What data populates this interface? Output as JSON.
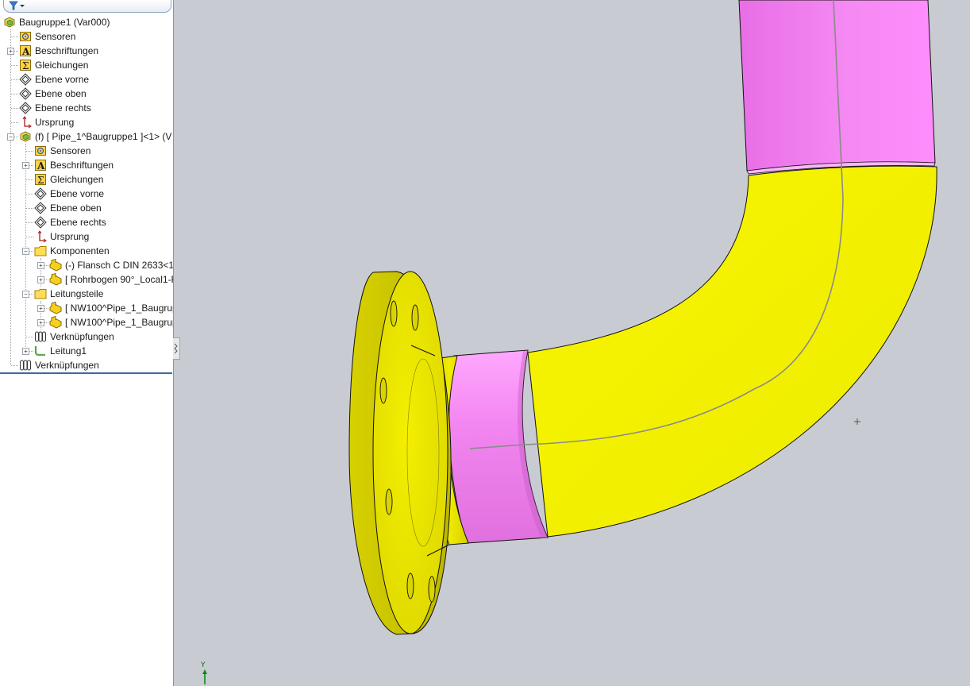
{
  "feature_tree": {
    "root": {
      "label": "Baugruppe1  (Var000)"
    },
    "items": [
      {
        "label": "Sensoren",
        "icon": "sensor-icon"
      },
      {
        "label": "Beschriftungen",
        "icon": "annotation-icon"
      },
      {
        "label": "Gleichungen",
        "icon": "equation-icon"
      },
      {
        "label": "Ebene vorne",
        "icon": "plane-icon"
      },
      {
        "label": "Ebene oben",
        "icon": "plane-icon"
      },
      {
        "label": "Ebene rechts",
        "icon": "plane-icon"
      },
      {
        "label": "Ursprung",
        "icon": "origin-icon"
      },
      {
        "label": "(f) [ Pipe_1^Baugruppe1 ]<1> (V",
        "icon": "subassembly-icon"
      },
      {
        "label": "Sensoren",
        "icon": "sensor-icon"
      },
      {
        "label": "Beschriftungen",
        "icon": "annotation-icon"
      },
      {
        "label": "Gleichungen",
        "icon": "equation-icon"
      },
      {
        "label": "Ebene vorne",
        "icon": "plane-icon"
      },
      {
        "label": "Ebene oben",
        "icon": "plane-icon"
      },
      {
        "label": "Ebene rechts",
        "icon": "plane-icon"
      },
      {
        "label": "Ursprung",
        "icon": "origin-icon"
      },
      {
        "label": "Komponenten",
        "icon": "folder-icon"
      },
      {
        "label": "(-) Flansch C DIN 2633<1:",
        "icon": "part-icon"
      },
      {
        "label": "[ Rohrbogen 90°_Local1-P",
        "icon": "part-icon"
      },
      {
        "label": "Leitungsteile",
        "icon": "folder-icon"
      },
      {
        "label": "[ NW100^Pipe_1_Baugrup",
        "icon": "part-icon"
      },
      {
        "label": "[ NW100^Pipe_1_Baugrup",
        "icon": "part-icon"
      },
      {
        "label": "Verknüpfungen",
        "icon": "mates-icon"
      },
      {
        "label": "Leitung1",
        "icon": "route-icon"
      },
      {
        "label": "Verknüpfungen",
        "icon": "mates-icon"
      }
    ]
  },
  "viewport": {
    "axis_label": "Y",
    "colors": {
      "background": "#c9cbd2",
      "flange": "#f0ea00",
      "elbow": "#f6f300",
      "pipe": "#f27ef0",
      "centerline": "#8a8a8a"
    }
  }
}
